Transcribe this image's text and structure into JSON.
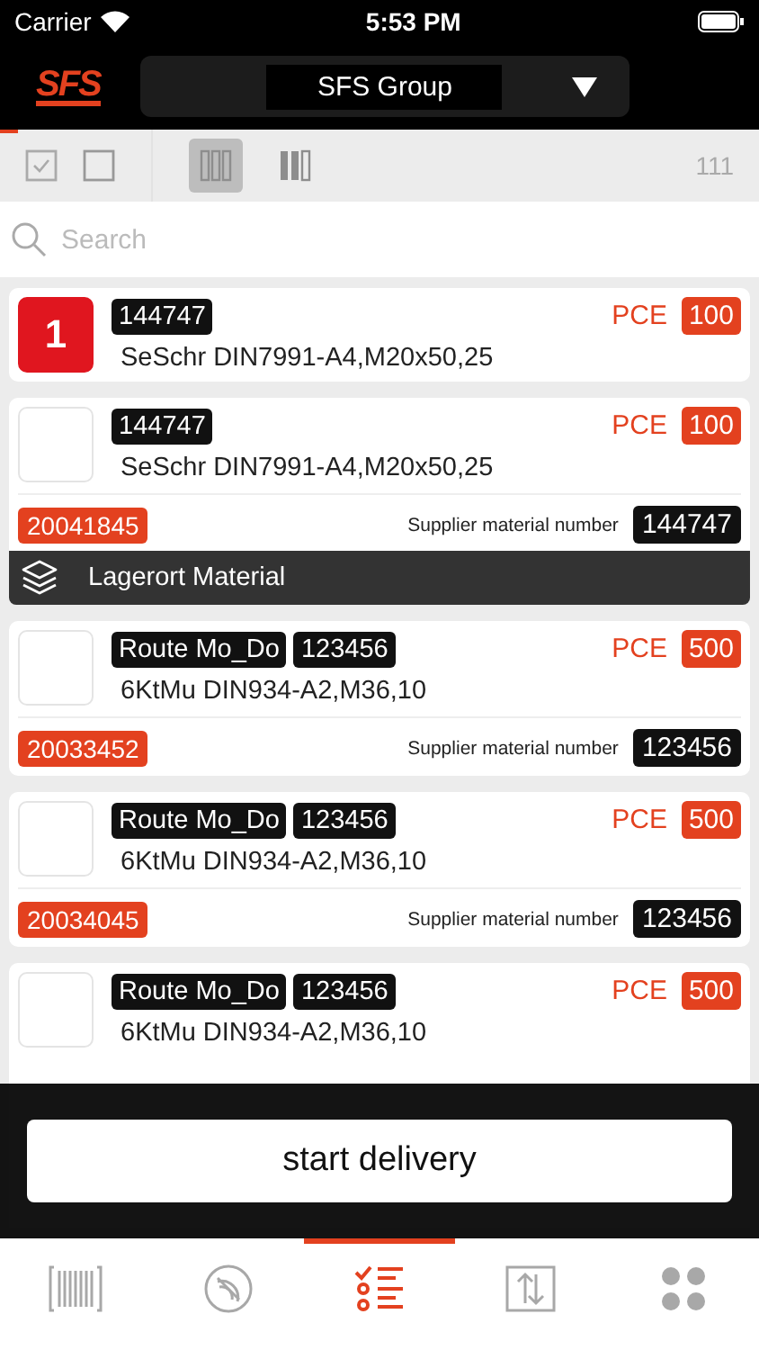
{
  "status_bar": {
    "carrier": "Carrier",
    "time": "5:53 PM"
  },
  "header": {
    "logo": "SFS",
    "company": "SFS Group"
  },
  "toolbar": {
    "checkboxes": [
      {
        "checked": true
      },
      {
        "checked": false
      }
    ],
    "view_modes": [
      {
        "kind": "three",
        "selected": true
      },
      {
        "kind": "two",
        "selected": false
      }
    ],
    "count": "111"
  },
  "search": {
    "placeholder": "Search"
  },
  "list": [
    {
      "kind": "item",
      "selected": true,
      "count": "1",
      "tags": [
        "144747"
      ],
      "name": "SeSchr DIN7991-A4,M20x50,25",
      "unit": "PCE",
      "quantity": "100"
    },
    {
      "kind": "item",
      "selected": false,
      "tags": [
        "144747"
      ],
      "name": "SeSchr DIN7991-A4,M20x50,25",
      "unit": "PCE",
      "quantity": "100",
      "article": "20041845",
      "supplier_label": "Supplier material number",
      "supplier_number": "144747"
    },
    {
      "kind": "section",
      "label": "Lagerort Material"
    },
    {
      "kind": "item",
      "selected": false,
      "tags": [
        "Route Mo_Do",
        "123456"
      ],
      "name": "6KtMu DIN934-A2,M36,10",
      "unit": "PCE",
      "quantity": "500",
      "article": "20033452",
      "supplier_label": "Supplier material number",
      "supplier_number": "123456"
    },
    {
      "kind": "item",
      "selected": false,
      "tags": [
        "Route Mo_Do",
        "123456"
      ],
      "name": "6KtMu DIN934-A2,M36,10",
      "unit": "PCE",
      "quantity": "500",
      "article": "20034045",
      "supplier_label": "Supplier material number",
      "supplier_number": "123456"
    },
    {
      "kind": "item",
      "selected": false,
      "tags": [
        "Route Mo_Do",
        "123456"
      ],
      "name": "6KtMu DIN934-A2,M36,10",
      "unit": "PCE",
      "quantity": "500"
    }
  ],
  "action": {
    "label": "start delivery"
  },
  "tab_bar": [
    {
      "kind": "barcode",
      "selected": false
    },
    {
      "kind": "dial",
      "selected": false
    },
    {
      "kind": "checklist",
      "selected": true
    },
    {
      "kind": "transfer",
      "selected": false
    },
    {
      "kind": "grid",
      "selected": false
    }
  ]
}
